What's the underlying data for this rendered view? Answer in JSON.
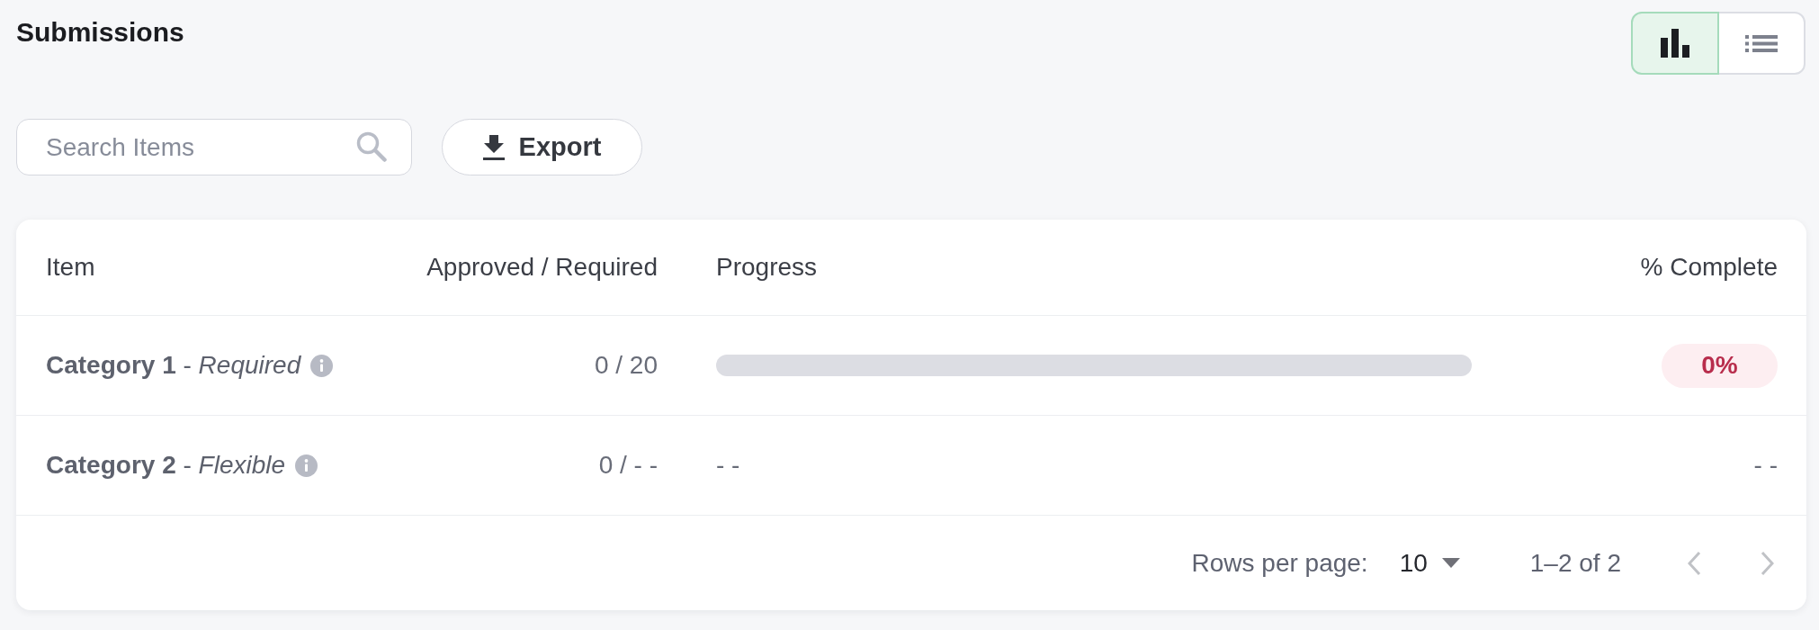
{
  "title": "Submissions",
  "view_toggle": [
    {
      "kind": "chart",
      "selected": true
    },
    {
      "kind": "list",
      "selected": false
    }
  ],
  "search": {
    "placeholder": "Search Items"
  },
  "export_button": {
    "label": "Export"
  },
  "table": {
    "columns": [
      "Item",
      "Approved / Required",
      "Progress",
      "% Complete"
    ],
    "rows": [
      {
        "label": "**Category 1** - *Required*",
        "info": true,
        "approved": "0 / 20",
        "progress": {
          "kind": "bar",
          "level": 0
        },
        "complete": {
          "kind": "badge",
          "text": "0%"
        }
      },
      {
        "label": "**Category 2** - *Flexible*",
        "info": true,
        "approved": "0 / - -",
        "progress": {
          "kind": "text",
          "text": "- -"
        },
        "complete": {
          "kind": "text",
          "text": "- -"
        }
      }
    ]
  },
  "footer": {
    "rows_per_page_label": "Rows per page:",
    "rows_per_page": "10",
    "range": "1–2 of 2",
    "pager": [
      {
        "kind": "previous",
        "disabled": true
      },
      {
        "kind": "next",
        "disabled": true
      }
    ]
  }
}
